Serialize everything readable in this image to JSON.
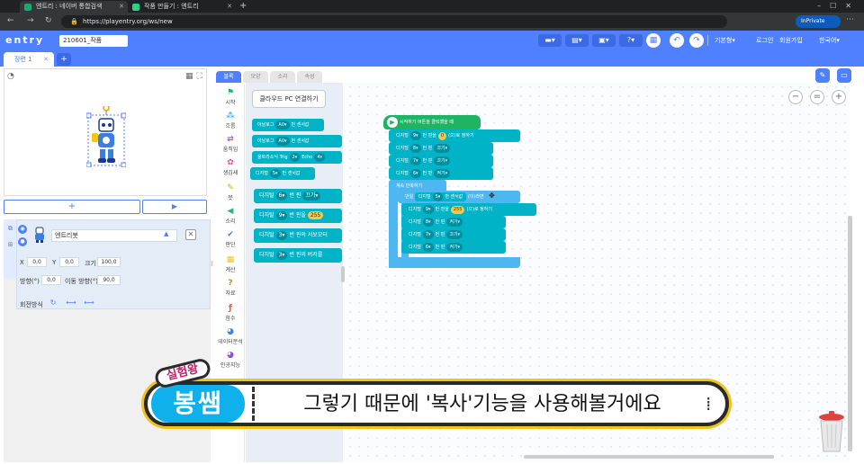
{
  "browser": {
    "tabs": [
      {
        "title": "엔트리 : 네이버 통합검색"
      },
      {
        "title": "작품 만들기 : 엔트리"
      }
    ],
    "url": "https://playentry.org/ws/new",
    "inprivate_label": "InPrivate"
  },
  "entry_header": {
    "logo": "entry",
    "project_name": "210601_작품",
    "mode_label": "기본형",
    "login": "로그인",
    "signup": "회원가입",
    "language": "한국어"
  },
  "scene": {
    "tab_label": "장면 1",
    "add_label": "+"
  },
  "stage": {
    "add_object": "+",
    "start": "▶"
  },
  "object": {
    "name": "엔트리봇",
    "x_label": "X",
    "x_value": "0,0",
    "y_label": "Y",
    "y_value": "0,0",
    "size_label": "크기",
    "size_value": "100,0",
    "direction_label": "방향(°)",
    "direction_value": "0,0",
    "move_direction_label": "이동 방향(°)",
    "move_direction_value": "90,0",
    "rotation_label": "회전방식"
  },
  "block_tabs": {
    "block": "블록",
    "shape": "모양",
    "sound": "소리",
    "attribute": "속성"
  },
  "categories": [
    {
      "label": "시작",
      "color": "#1eb464"
    },
    {
      "label": "흐름",
      "color": "#4cb7f0"
    },
    {
      "label": "움직임",
      "color": "#9c5ce0"
    },
    {
      "label": "생김새",
      "color": "#e04c8c"
    },
    {
      "label": "붓",
      "color": "#f2a000"
    },
    {
      "label": "소리",
      "color": "#2bb673"
    },
    {
      "label": "판단",
      "color": "#3c8ad0"
    },
    {
      "label": "계산",
      "color": "#f2c318"
    },
    {
      "label": "자료",
      "color": "#c98a16"
    },
    {
      "label": "함수",
      "color": "#ef5b2c"
    },
    {
      "label": "데이터분석",
      "color": "#3c8ad0"
    },
    {
      "label": "인공지능",
      "color": "#8a52d6"
    }
  ],
  "palette": {
    "cloud_button": "클라우드 PC 연결하기",
    "b1_a": "아날로그",
    "b1_b": "A0▾",
    "b1_c": "번 센서값",
    "b2_a": "아날로그",
    "b2_b": "A0▾",
    "b2_c": "번 센서값",
    "b3_a": "울트라소닉 Trig",
    "b3_b": "2▾",
    "b3_c": "Echo",
    "b3_d": "4▾",
    "b4_a": "디지털",
    "b4_b": "5▾",
    "b4_c": "번 센서값",
    "b5_a": "디지털",
    "b5_b": "6▾",
    "b5_c": "번 핀",
    "b5_d": "끄기▾",
    "b6_a": "디지털",
    "b6_b": "9▾",
    "b6_c": "번 핀을",
    "b6_d": "255",
    "b7_a": "디지털",
    "b7_b": "3▾",
    "b7_c": "번 핀의 서보모터",
    "b8_a": "디지털",
    "b8_b": "3▾",
    "b8_c": "번 핀의 버저를"
  },
  "script": {
    "hat": "시작하기 버튼을 클릭했을 때",
    "rows": [
      {
        "a": "디지털",
        "b": "9▾",
        "c": "번 핀을",
        "d": "0",
        "e": "(으)로 정하기"
      },
      {
        "a": "디지털",
        "b": "8▾",
        "c": "번 핀",
        "d": "끄기▾"
      },
      {
        "a": "디지털",
        "b": "7▾",
        "c": "번 핀",
        "d": "끄기▾"
      },
      {
        "a": "디지털",
        "b": "6▾",
        "c": "번 핀",
        "d": "켜기▾"
      }
    ],
    "loop": "계속 반복하기",
    "if_a": "만일",
    "if_b": "디지털",
    "if_c": "5▾",
    "if_d": "번 센서값",
    "if_e": "(이)라면",
    "inner": [
      {
        "a": "디지털",
        "b": "9▾",
        "c": "번 핀을",
        "d": "255",
        "e": "(으)로 정하기"
      },
      {
        "a": "디지털",
        "b": "8▾",
        "c": "번 핀",
        "d": "켜기▾"
      },
      {
        "a": "디지털",
        "b": "7▾",
        "c": "번 핀",
        "d": "끄기▾"
      },
      {
        "a": "디지털",
        "b": "6▾",
        "c": "번 핀",
        "d": "켜기▾"
      }
    ]
  },
  "subtitle": {
    "tag": "실험왕",
    "name": "봉쌤",
    "text": "그렇기 때문에 '복사'기능을 사용해볼거에요"
  },
  "colors": {
    "entry_blue": "#4f80ff",
    "hardware_block": "#00b3c7",
    "start_block": "#1eb464",
    "flow_block": "#4cb7f0"
  }
}
